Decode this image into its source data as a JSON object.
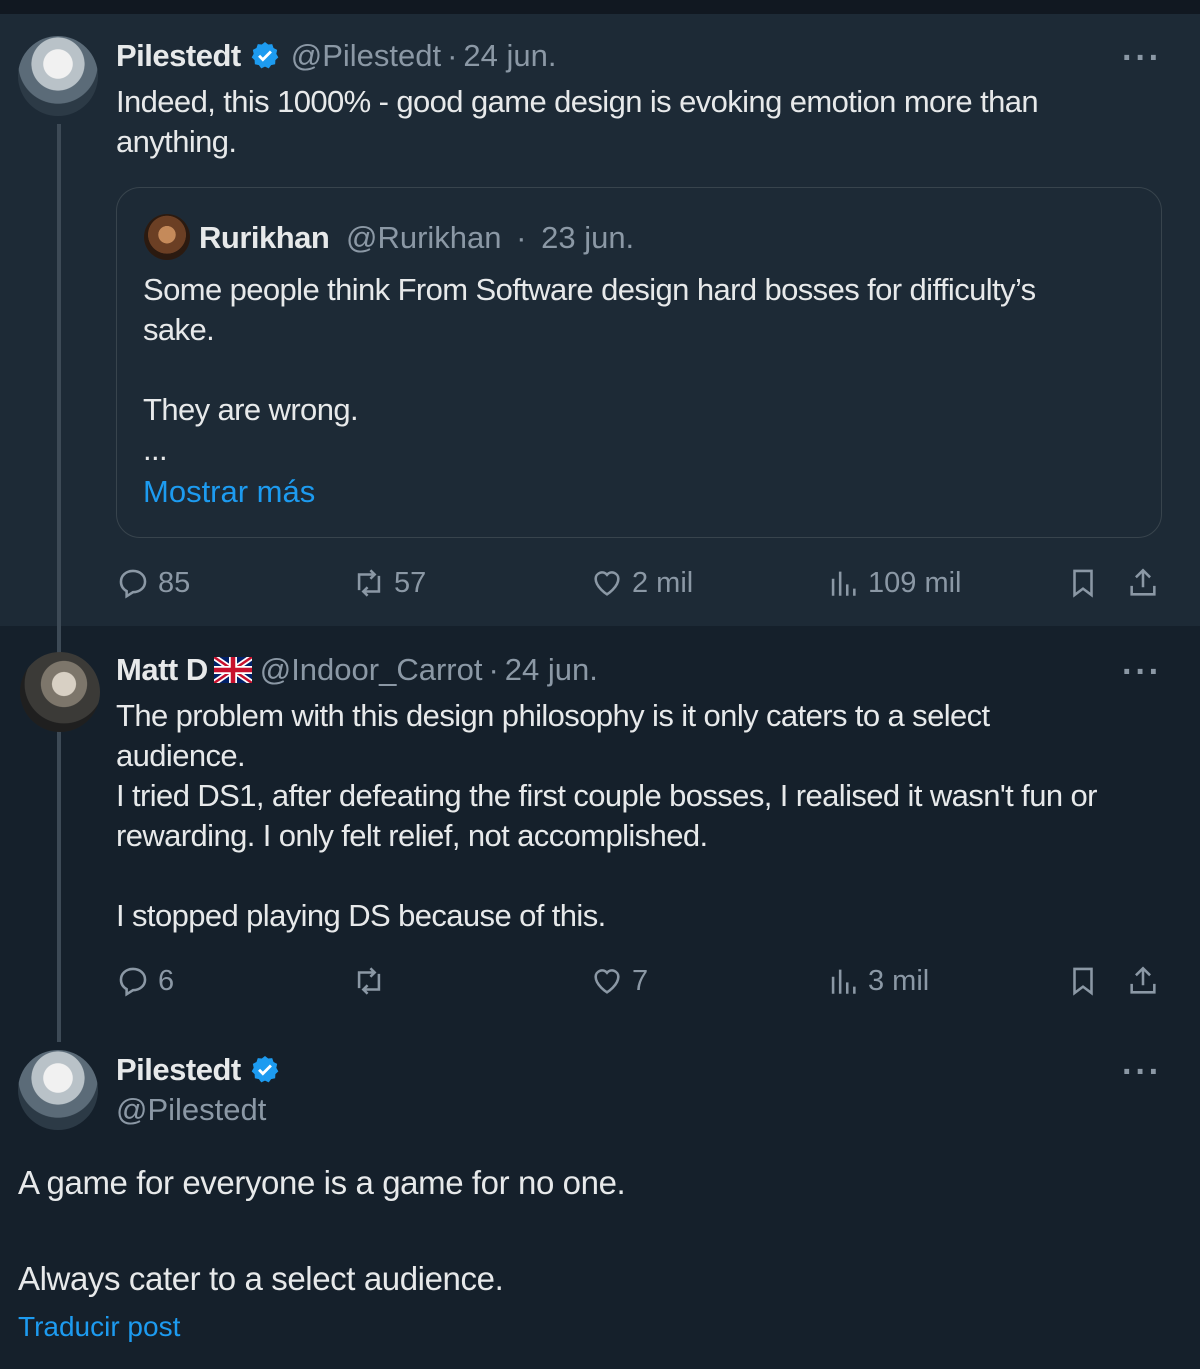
{
  "tweets": [
    {
      "name": "Pilestedt",
      "handle": "@Pilestedt",
      "date": "24 jun.",
      "verified": true,
      "text": "Indeed, this 1000% - good game design is evoking emotion more than\nanything.",
      "quote": {
        "name": "Rurikhan",
        "handle": "@Rurikhan",
        "date": "23 jun.",
        "text": "Some people think From Software design hard bosses for difficulty’s\nsake.\n\nThey are wrong.\n...",
        "show_more": "Mostrar más"
      },
      "stats": {
        "replies": "85",
        "retweets": "57",
        "likes": "2 mil",
        "views": "109 mil"
      }
    },
    {
      "name": "Matt D",
      "handle": "@Indoor_Carrot",
      "date": "24 jun.",
      "flag": "uk-flag",
      "text": "The problem with this design philosophy is it only caters to a select\naudience.\nI tried DS1, after defeating the first couple bosses, I realised it wasn't fun or\nrewarding. I only felt relief, not accomplished.\n\nI stopped playing DS because of this.",
      "stats": {
        "replies": "6",
        "retweets": "",
        "likes": "7",
        "views": "3 mil"
      }
    }
  ],
  "main_tweet": {
    "name": "Pilestedt",
    "handle": "@Pilestedt",
    "verified": true,
    "line1": "A game for everyone is a game for no one.",
    "line2": "Always cater to a select audience.",
    "translate": "Traducir post"
  },
  "more_symbol": "···",
  "colors": {
    "background": "#15202b",
    "highlight": "#1d2a36",
    "accent": "#1d9bf0",
    "muted": "#8b98a5"
  }
}
